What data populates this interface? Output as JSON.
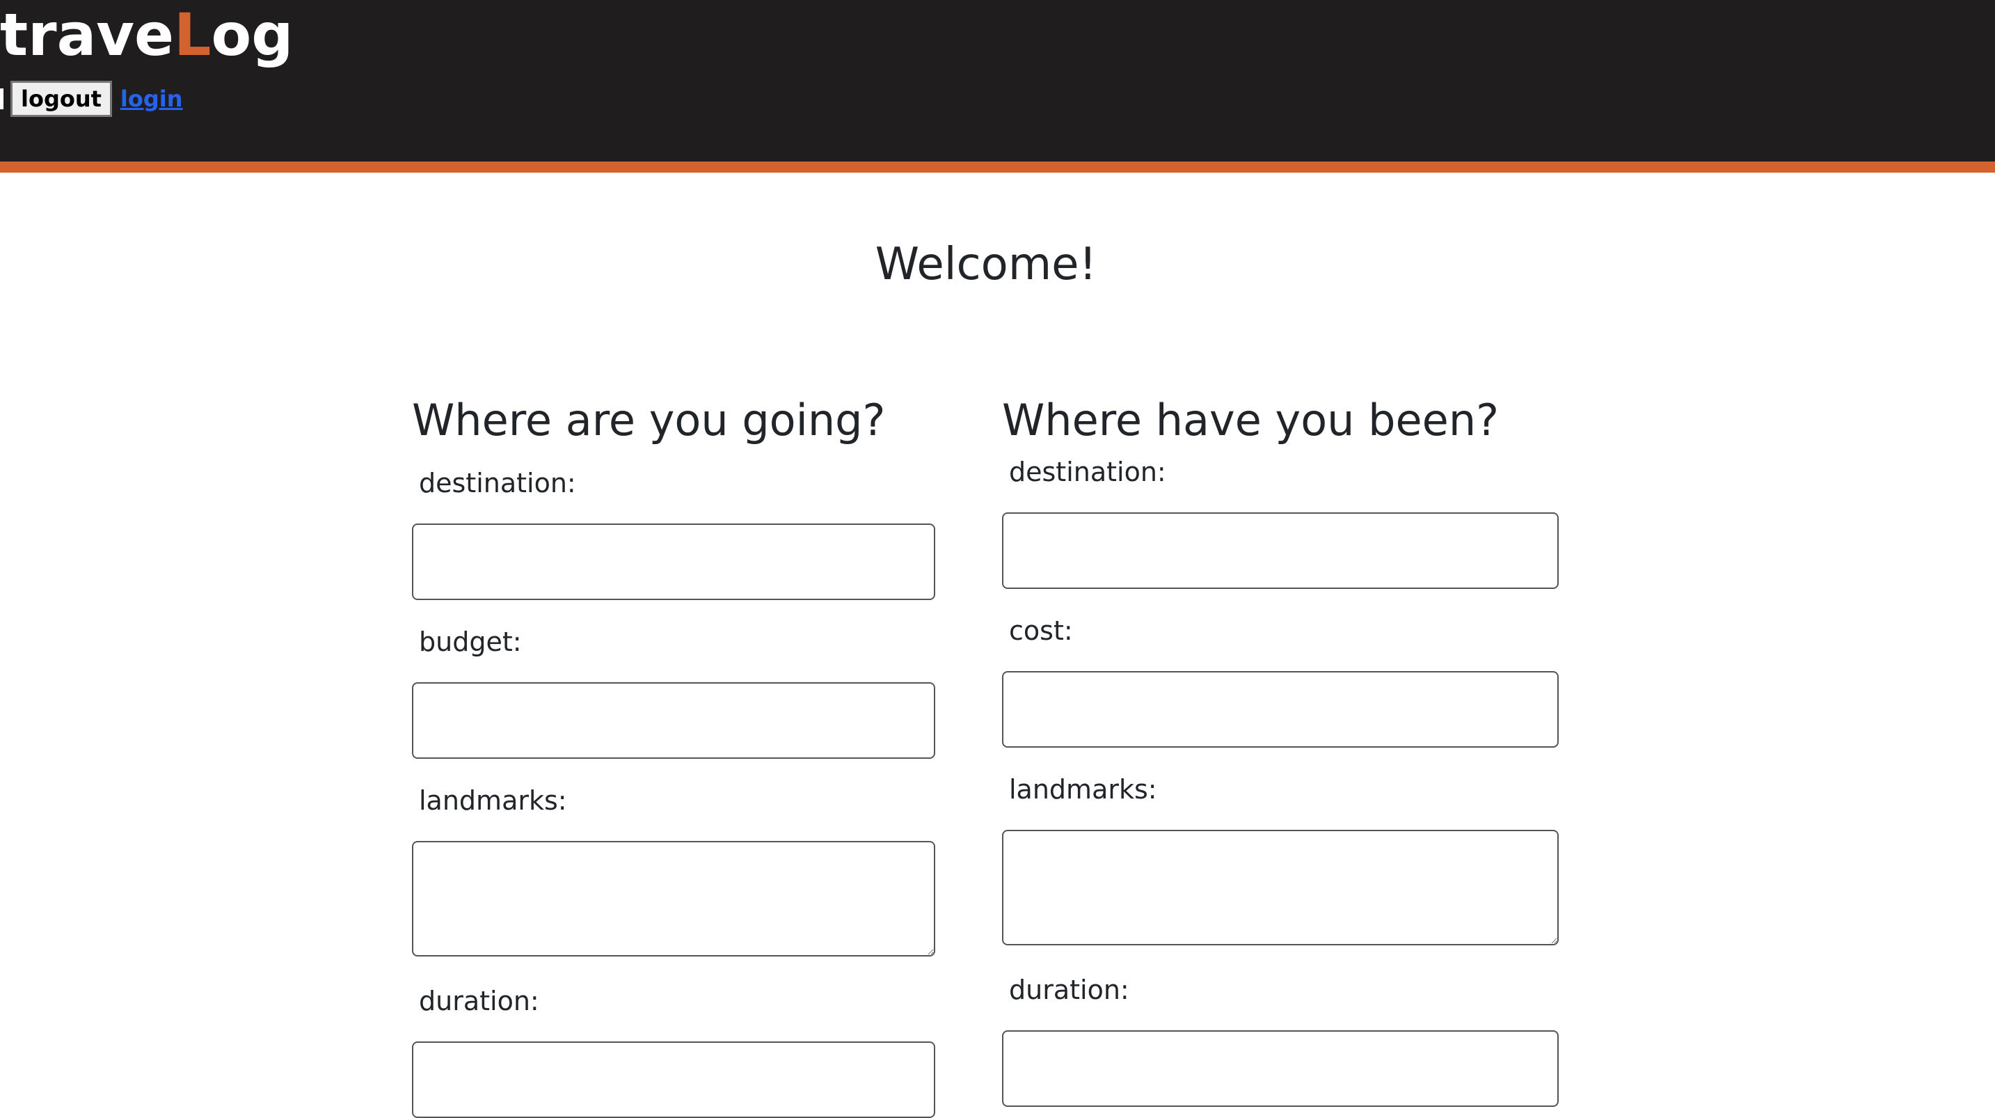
{
  "header": {
    "logo_prefix": "trave",
    "logo_accent": "L",
    "logo_suffix": "og",
    "logout_label": "logout",
    "login_label": "login",
    "accent_color": "#d4622f",
    "background_color": "#201d1e"
  },
  "main": {
    "welcome": "Welcome!"
  },
  "going": {
    "heading": "Where are you going?",
    "destination_label": "destination:",
    "destination_value": "",
    "budget_label": "budget:",
    "budget_value": "",
    "landmarks_label": "landmarks:",
    "landmarks_value": "",
    "duration_label": "duration:",
    "duration_value": ""
  },
  "been": {
    "heading": "Where have you been?",
    "destination_label": "destination:",
    "destination_value": "",
    "cost_label": "cost:",
    "cost_value": "",
    "landmarks_label": "landmarks:",
    "landmarks_value": "",
    "duration_label": "duration:",
    "duration_value": ""
  }
}
